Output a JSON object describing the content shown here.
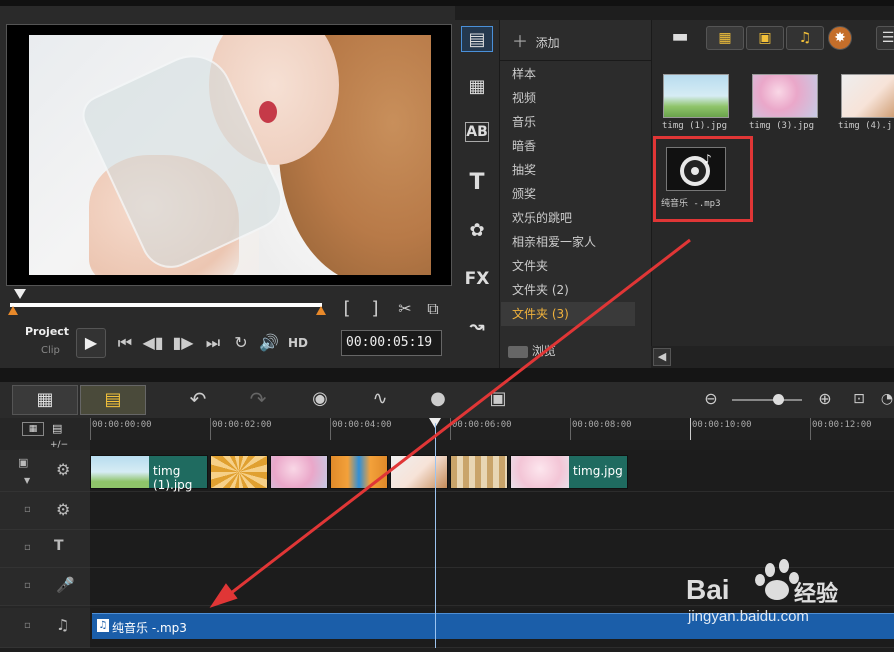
{
  "preview": {
    "mode_project": "Project",
    "mode_clip": "Clip",
    "timecode": "00:00:05:19",
    "hd_label": "HD",
    "mark_in": "[",
    "mark_out": "]"
  },
  "library": {
    "add_label": "添加",
    "categories": [
      "样本",
      "视频",
      "音乐",
      "暗香",
      "抽奖",
      "颁奖",
      "欢乐的跳吧",
      "相亲相爱一家人",
      "文件夹",
      "文件夹 (2)",
      "文件夹 (3)"
    ],
    "selected_index": 10,
    "browse_label": "浏览",
    "side_icons": [
      "media-icon",
      "instant-project-icon",
      "title-icon",
      "text-icon",
      "graphic-icon",
      "fx-icon",
      "path-icon"
    ],
    "fx_label": "FX",
    "ab_label": "AB",
    "t_label": "T",
    "items": [
      {
        "name": "timg (1).jpg"
      },
      {
        "name": "timg (3).jpg"
      },
      {
        "name": "timg (4).j"
      },
      {
        "name": "纯音乐 -.mp3"
      }
    ]
  },
  "timeline": {
    "ruler": [
      "00:00:00:00",
      "00:00:02:00",
      "00:00:04:00",
      "00:00:06:00",
      "00:00:08:00",
      "00:00:10:00",
      "00:00:12:00"
    ],
    "clips": [
      {
        "label": "timg (1).jpg"
      },
      {
        "label": ""
      },
      {
        "label": ""
      },
      {
        "label": ""
      },
      {
        "label": ""
      },
      {
        "label": ""
      },
      {
        "label": "timg.jpg"
      }
    ],
    "audio_clip": "纯音乐 -.mp3",
    "add_remove": "+/−"
  },
  "watermark": {
    "brand_text": "Bai",
    "brand_suffix": "经验",
    "url": "jingyan.baidu.com"
  },
  "colors": {
    "highlight": "#e03636",
    "audio_clip": "#1b5ea9",
    "selected_category": "#f0b23c",
    "clip_green": "#1f6b60"
  }
}
